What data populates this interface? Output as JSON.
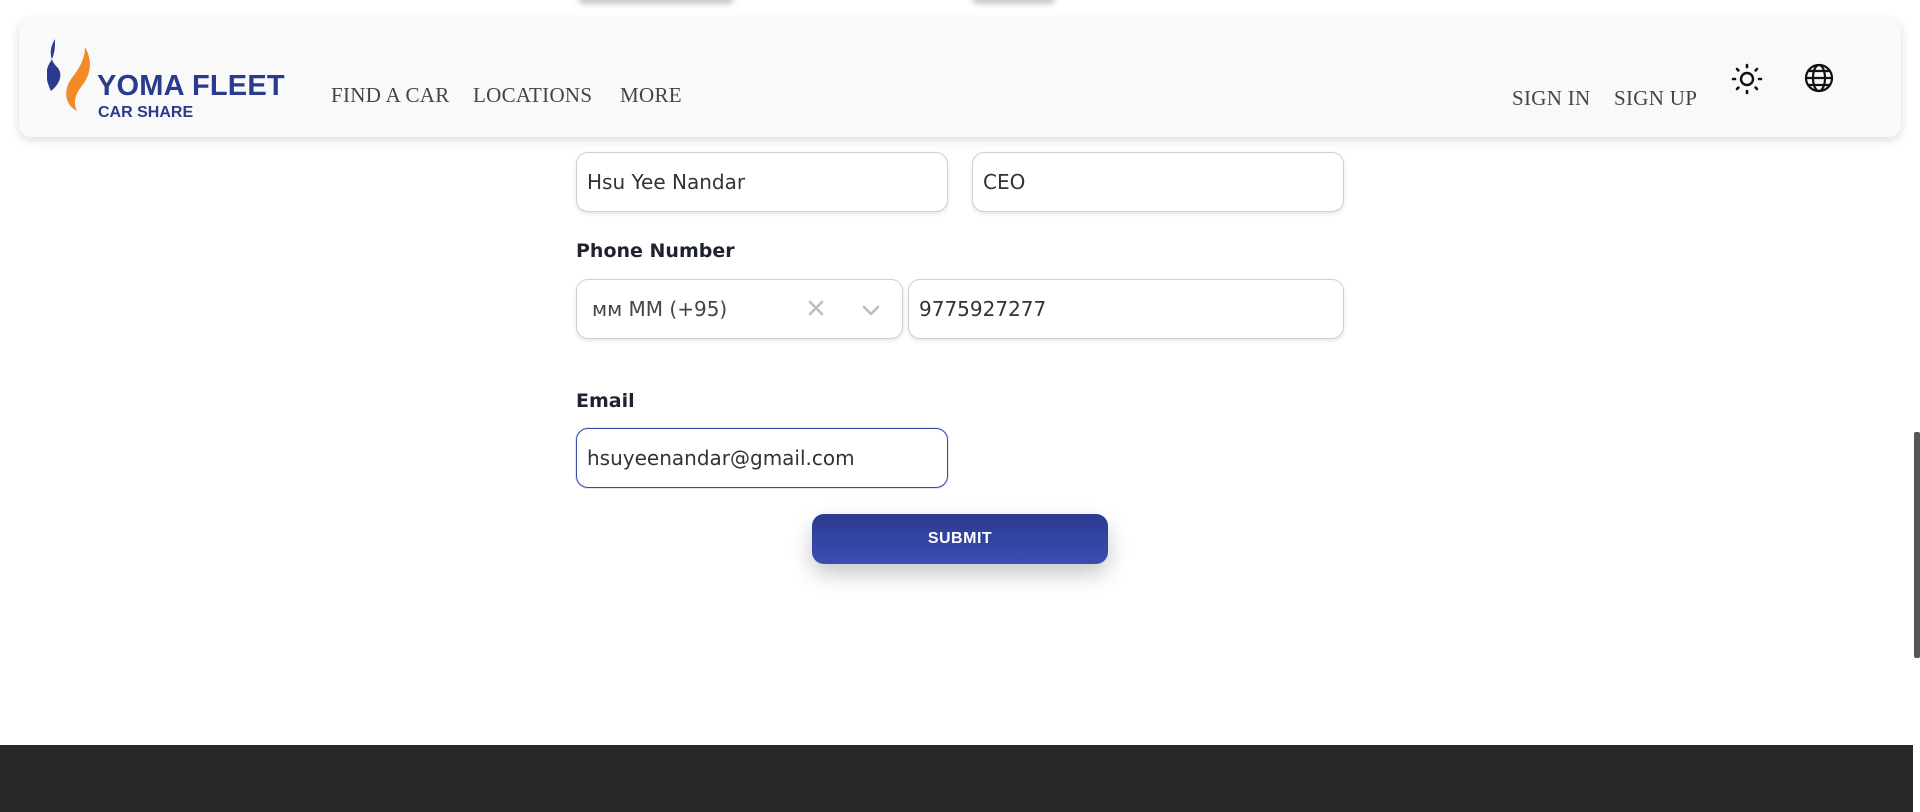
{
  "brand": {
    "title": "YOMA FLEET",
    "subtitle": "CAR SHARE",
    "primary_color": "#2a3a8c",
    "accent_color": "#f28a28"
  },
  "nav": {
    "links": [
      "FIND A CAR",
      "LOCATIONS",
      "MORE"
    ],
    "sign_in": "SIGN IN",
    "sign_up": "SIGN UP",
    "theme_icon": "sun-icon",
    "language_icon": "globe-icon"
  },
  "form": {
    "name_value": "Hsu Yee Nandar",
    "position_value": "CEO",
    "phone_label": "Phone Number",
    "country_code": "мм MM (+95)",
    "phone_value": "9775927277",
    "email_label": "Email",
    "email_value": "hsuyeenandar@gmail.com",
    "submit_label": "SUBMIT",
    "submit_color": "#2b3a90"
  },
  "footer": {
    "background": "#29292b"
  }
}
